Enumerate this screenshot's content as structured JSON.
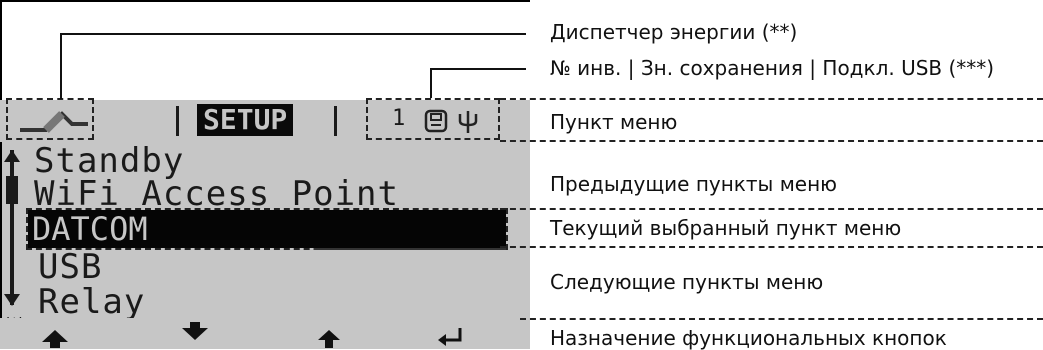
{
  "lcd": {
    "setup_label": "SETUP",
    "status_number": "1",
    "status_symbols": "💾 Ψ",
    "menu_prev": [
      "Standby",
      "WiFi Access Point"
    ],
    "menu_selected": "DATCOM",
    "menu_next": [
      "USB",
      "Relay"
    ],
    "footnote_marker": "(*)",
    "function_buttons": [
      "▲",
      "▼",
      "↑",
      "↵"
    ]
  },
  "callouts": {
    "energy_manager": "Диспетчер энергии (**)",
    "inverter_status": "№ инв. | Зн. сохранения | Подкл. USB (***)",
    "menu_item": "Пункт меню",
    "previous_items": "Предыдущие пункты меню",
    "current_item": "Текущий выбранный пункт меню",
    "next_items": "Следующие пункты меню",
    "function_buttons": "Назначение функциональных кнопок"
  }
}
